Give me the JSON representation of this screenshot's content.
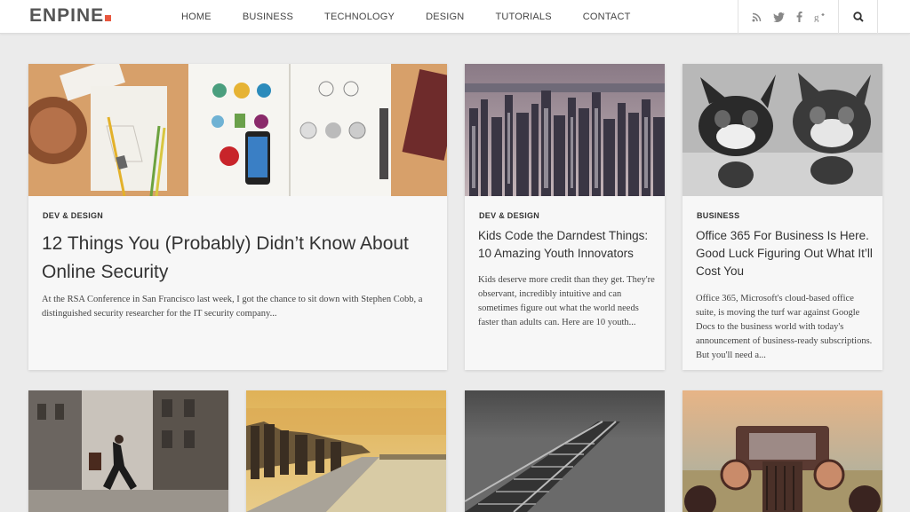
{
  "logo": {
    "text": "ENPINE",
    "accent_color": "#e8573f"
  },
  "nav": {
    "items": [
      "HOME",
      "BUSINESS",
      "TECHNOLOGY",
      "DESIGN",
      "TUTORIALS",
      "CONTACT"
    ]
  },
  "social": {
    "icons": [
      "rss-icon",
      "twitter-icon",
      "facebook-icon",
      "google-plus-icon"
    ]
  },
  "search": {
    "icon": "search-icon"
  },
  "posts": [
    {
      "category": "DEV & DESIGN",
      "title": "12 Things You (Probably) Didn’t Know About Online Security",
      "excerpt": "At the RSA Conference in San Francisco last week, I got the chance to sit down with Stephen Cobb, a distinguished security researcher for the IT security company..."
    },
    {
      "category": "DEV & DESIGN",
      "title": "Kids Code the Darndest Things: 10 Amazing Youth Innovators",
      "excerpt": "Kids deserve more credit than they get. They're observant, incredibly intuitive and can sometimes figure out what the world needs faster than adults can. Here are 10 youth..."
    },
    {
      "category": "BUSINESS",
      "title": "Office 365 For Business Is Here. Good Luck Figuring Out What It’ll Cost You",
      "excerpt": "Office 365, Microsoft's cloud-based office suite, is moving the turf war against Google Docs to the business world with today's announcement of business-ready subscriptions. But you'll need a..."
    }
  ]
}
